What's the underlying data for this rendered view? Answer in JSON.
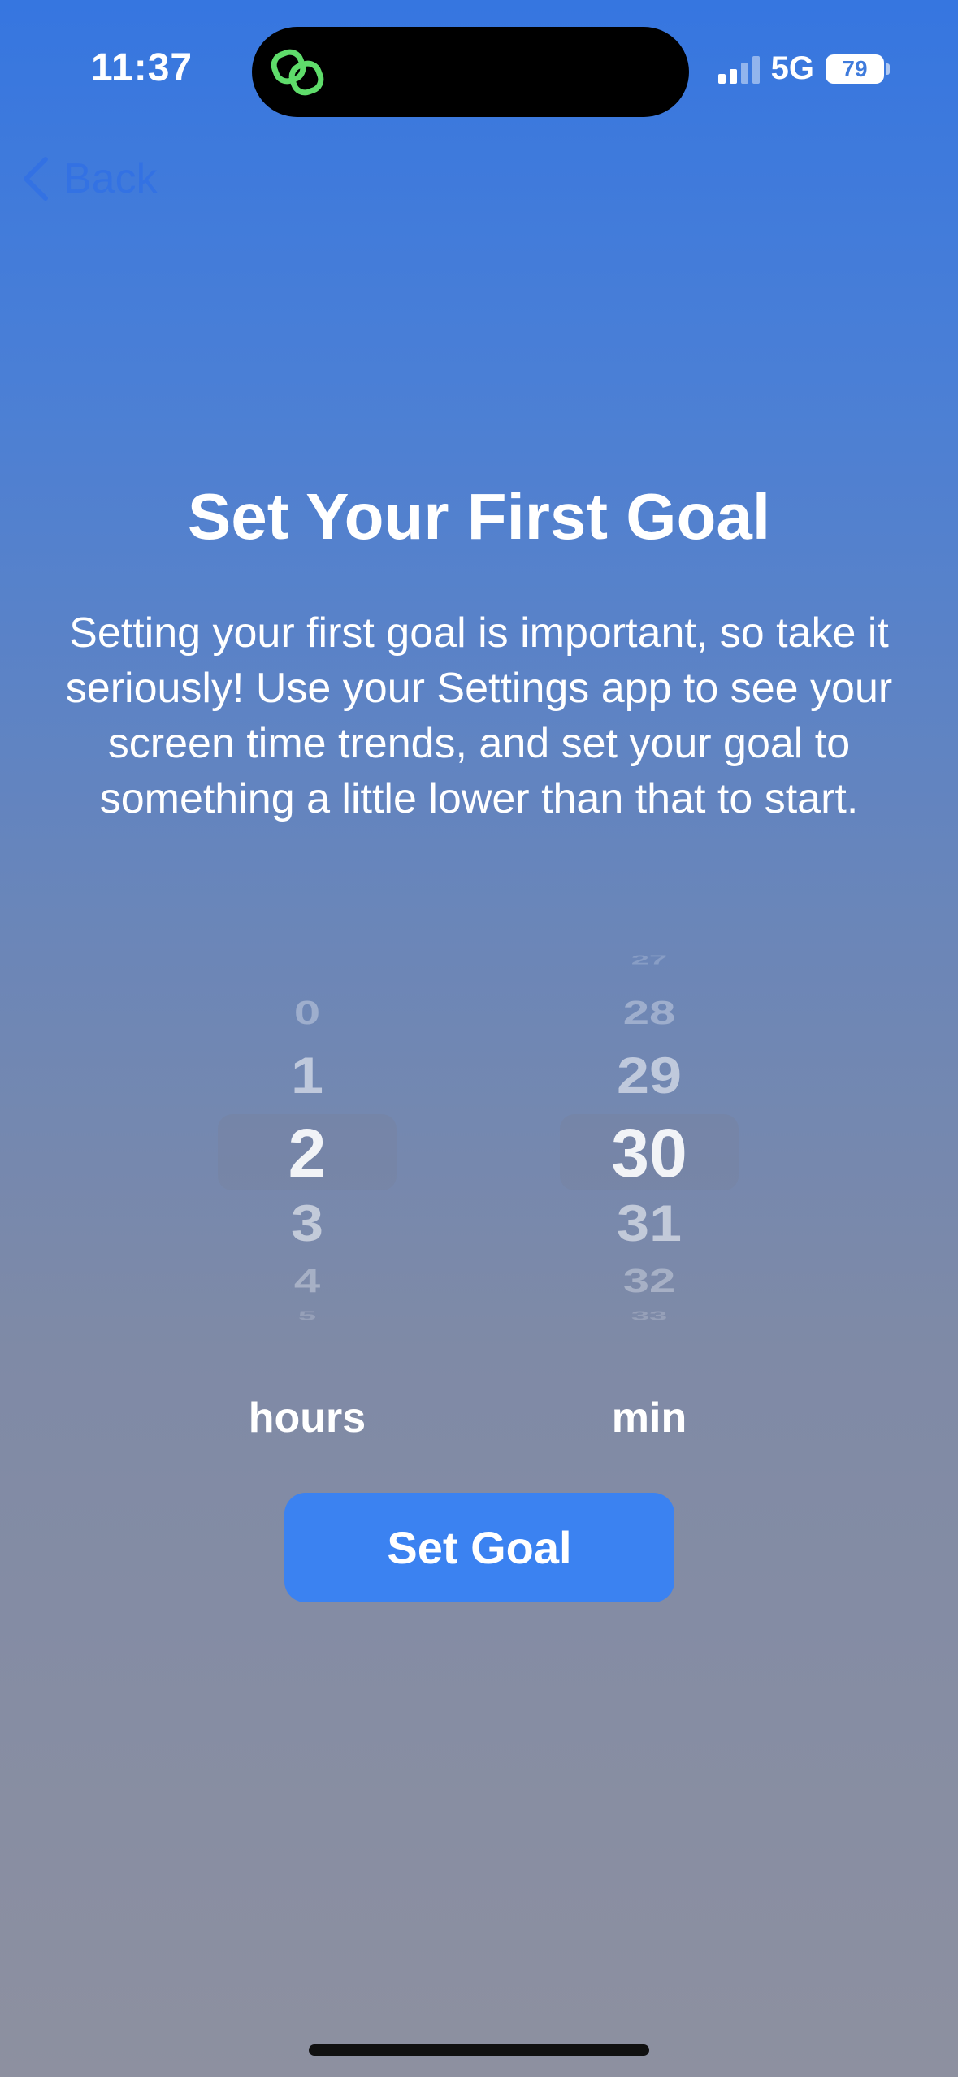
{
  "status_bar": {
    "time": "11:37",
    "network": "5G",
    "battery_level": "79"
  },
  "nav": {
    "back_label": "Back"
  },
  "content": {
    "title": "Set Your First Goal",
    "description": "Setting your first goal is important, so take it seriously! Use your Settings app to see your screen time trends, and set your goal to something a little lower than that to start."
  },
  "picker": {
    "hours": {
      "visible_values": [
        "0",
        "1",
        "2",
        "3",
        "4",
        "5"
      ],
      "selected": "2",
      "label": "hours"
    },
    "minutes": {
      "visible_values": [
        "27",
        "28",
        "29",
        "30",
        "31",
        "32",
        "33"
      ],
      "selected": "30",
      "label": "min"
    }
  },
  "actions": {
    "set_goal_label": "Set Goal"
  },
  "colors": {
    "accent": "#3b82f1",
    "back_link": "#2f6fe6"
  }
}
